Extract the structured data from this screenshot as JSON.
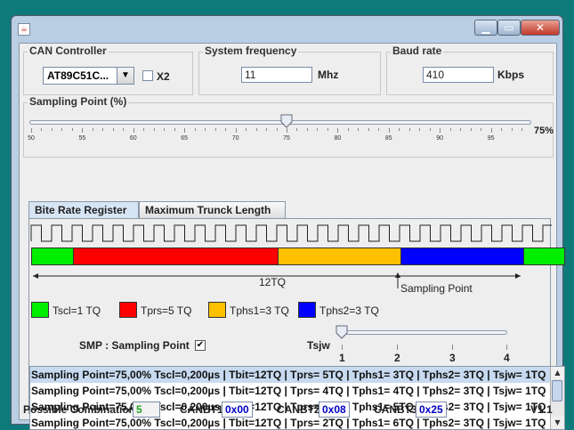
{
  "window": {
    "title_icon": "java-app-icon",
    "controls": {
      "minimize": "▁",
      "maximize": "▭",
      "close": "✕"
    }
  },
  "can_controller": {
    "title": "CAN Controller",
    "selected": "AT89C51C...",
    "x2_label": "X2",
    "x2_checked": false
  },
  "system_frequency": {
    "title": "System frequency",
    "value": "11",
    "unit": "Mhz"
  },
  "baud_rate": {
    "title": "Baud rate",
    "value": "410",
    "unit": "Kbps"
  },
  "sampling_point": {
    "title": "Sampling Point (%)",
    "value_label": "75%",
    "value_fraction": 0.75,
    "ticks": [
      "50",
      "55",
      "60",
      "65",
      "70",
      "75",
      "80",
      "85",
      "90",
      "95"
    ]
  },
  "tabs": [
    {
      "label": "Bite Rate Register",
      "active": true
    },
    {
      "label": "Maximum Trunck Length",
      "active": false
    }
  ],
  "timing": {
    "total_label": "12TQ",
    "sampling_point_label": "Sampling Point",
    "segments": [
      {
        "name": "Tscl",
        "tq": 1,
        "color": "#00ee00"
      },
      {
        "name": "Tprs",
        "tq": 5,
        "color": "#ff0000"
      },
      {
        "name": "Tphs1",
        "tq": 3,
        "color": "#ffc000"
      },
      {
        "name": "Tphs2",
        "tq": 3,
        "color": "#0000ff"
      },
      {
        "name": "Tscl",
        "tq": 1,
        "color": "#00ee00"
      }
    ],
    "legend": [
      {
        "label": "Tscl=1 TQ",
        "color": "#00ee00"
      },
      {
        "label": "Tprs=5 TQ",
        "color": "#ff0000"
      },
      {
        "label": "Tphs1=3 TQ",
        "color": "#ffc000"
      },
      {
        "label": "Tphs2=3 TQ",
        "color": "#0000ff"
      }
    ]
  },
  "smp": {
    "label": "SMP : Sampling Point",
    "checked": true,
    "check_glyph": "✔"
  },
  "tsjw": {
    "label": "Tsjw",
    "ticks": [
      "1",
      "2",
      "3",
      "4"
    ],
    "value": 1
  },
  "results": [
    "Sampling Point=75,00% Tscl=0,200µs | Tbit=12TQ | Tprs=  5TQ | Tphs1=  3TQ | Tphs2=  3TQ | Tsjw=  1TQ",
    "Sampling Point=75,00% Tscl=0,200µs | Tbit=12TQ | Tprs=  4TQ | Tphs1=  4TQ | Tphs2=  3TQ | Tsjw=  1TQ",
    "Sampling Point=75,00% Tscl=0,200µs | Tbit=12TQ | Tprs=  3TQ | Tphs1=  5TQ | Tphs2=  3TQ | Tsjw=  1TQ",
    "Sampling Point=75,00% Tscl=0,200µs | Tbit=12TQ | Tprs=  2TQ | Tphs1=  6TQ | Tphs2=  3TQ | Tsjw=  1TQ"
  ],
  "footer": {
    "possible_label": "Possible Combination",
    "possible_value": "5",
    "canbt1_label": "CANBT1",
    "canbt1_value": "0x00",
    "canbt2_label": "CANBT2",
    "canbt2_value": "0x08",
    "canbt3_label": "CANBT3",
    "canbt3_value": "0x25",
    "version": "V1.1"
  }
}
